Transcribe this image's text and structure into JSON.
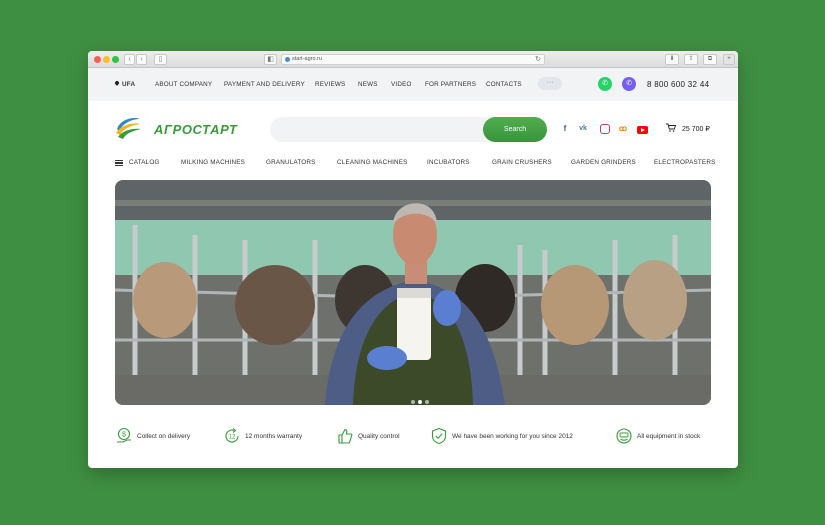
{
  "browser": {
    "url": "start-agro.ru"
  },
  "topbar": {
    "city": "UFA",
    "menu": [
      "ABOUT COMPANY",
      "PAYMENT AND DELIVERY",
      "REVIEWS",
      "NEWS",
      "VIDEO",
      "FOR PARTNERS",
      "CONTACTS"
    ],
    "more": "···",
    "phone": "8 800 600 32 44"
  },
  "header": {
    "logo": "АГРОСТАРТ",
    "search_placeholder": "",
    "search_button": "Search",
    "cart_total": "25 700 ₽",
    "social": [
      "f",
      "vk",
      "ig",
      "ok",
      "yt"
    ]
  },
  "catalog": {
    "label": "CATALOG",
    "items": [
      "MILKING MACHINES",
      "GRANULATORS",
      "CLEANING MACHINES",
      "INCUBATORS",
      "GRAIN CRUSHERS",
      "GARDEN GRINDERS",
      "ELECTROPASTERS"
    ]
  },
  "hero": {
    "slide_count": 3,
    "active_slide": 2
  },
  "features": [
    {
      "icon": "money-hand-icon",
      "label": "Collect on delivery"
    },
    {
      "icon": "warranty-12-icon",
      "label": "12 months warranty"
    },
    {
      "icon": "thumbs-up-icon",
      "label": "Quality control"
    },
    {
      "icon": "shield-check-icon",
      "label": "We have been working for you since 2012"
    },
    {
      "icon": "smile-icon",
      "label": "All equipment in stock"
    }
  ],
  "colors": {
    "brand_green": "#3a9a3c",
    "background": "#3f8f42",
    "topbar_bg": "#f1f3f5"
  }
}
